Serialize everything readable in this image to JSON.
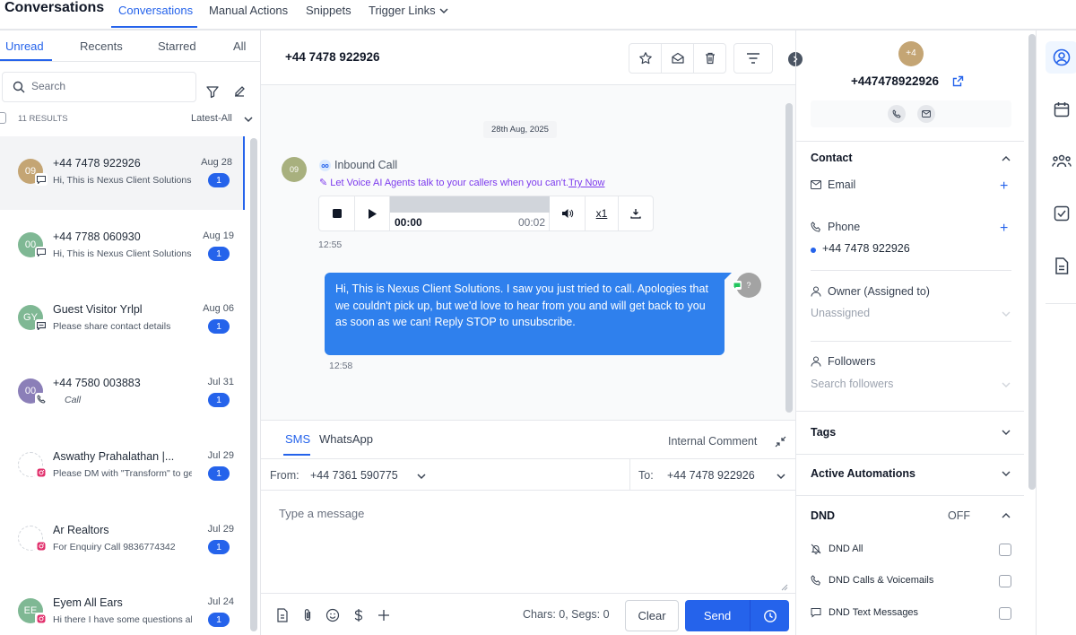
{
  "topnav": {
    "title": "Conversations",
    "tabs": [
      "Conversations",
      "Manual Actions",
      "Snippets",
      "Trigger Links"
    ]
  },
  "left": {
    "tabs": [
      "Unread",
      "Recents",
      "Starred",
      "All"
    ],
    "search_placeholder": "Search",
    "results": "11 RESULTS",
    "sort": "Latest-All",
    "conversations": [
      {
        "initials": "09",
        "name": "+44 7478 922926",
        "preview": "Hi, This is Nexus Client Solutions",
        "date": "Aug 28",
        "count": "1",
        "color": "#c4a574",
        "channel": "sms",
        "selected": true
      },
      {
        "initials": "00",
        "name": "+44 7788 060930",
        "preview": "Hi, This is Nexus Client Solutions.",
        "date": "Aug 19",
        "count": "1",
        "color": "#7fb894",
        "channel": "sms"
      },
      {
        "initials": "GY",
        "name": "Guest Visitor Yrlpl",
        "preview": "Please share contact details",
        "date": "Aug 06",
        "count": "1",
        "color": "#7fb894",
        "channel": "chat"
      },
      {
        "initials": "00",
        "name": "+44 7580 003883",
        "preview": "Call",
        "date": "Jul 31",
        "count": "1",
        "color": "#8b7fb8",
        "channel": "call"
      },
      {
        "initials": "",
        "name": "Aswathy Prahalathan |...",
        "preview": "Please DM with \"Transform\" to ge",
        "date": "Jul 29",
        "count": "1",
        "color": "",
        "channel": "instagram"
      },
      {
        "initials": "",
        "name": "Ar Realtors",
        "preview": "For Enquiry Call 9836774342",
        "date": "Jul 29",
        "count": "1",
        "color": "",
        "channel": "instagram"
      },
      {
        "initials": "EE",
        "name": "Eyem All Ears",
        "preview": "Hi there I have some questions ab",
        "date": "Jul 24",
        "count": "1",
        "color": "#7fb894",
        "channel": "instagram"
      }
    ]
  },
  "chat": {
    "header_name": "+44 7478 922926",
    "date_pill": "28th Aug, 2025",
    "inbound": {
      "avatar": "09",
      "title": "Inbound Call",
      "promo": "Let Voice AI Agents talk to your callers when you can't.",
      "promo_link": "Try Now",
      "audio_current": "00:00",
      "audio_total": "00:02",
      "speed": "x1",
      "progress": 0,
      "time": "12:55"
    },
    "outbound": {
      "text": "Hi, This is Nexus Client Solutions. I saw you just tried to call. Apologies that we couldn't pick up, but we'd love to hear from you and will get back to you as soon as we can! Reply STOP to unsubscribe.",
      "avatar": "?",
      "time": "12:58"
    }
  },
  "composer": {
    "tabs": [
      "SMS",
      "WhatsApp"
    ],
    "internal_comment": "Internal Comment",
    "from_label": "From:",
    "from_value": "+44 7361 590775",
    "to_label": "To:",
    "to_value": "+44 7478 922926",
    "placeholder": "Type a message",
    "char_count": "Chars: 0, Segs: 0",
    "clear": "Clear",
    "send": "Send"
  },
  "contact": {
    "avatar": "+4",
    "phone": "+447478922926",
    "section_contact": "Contact",
    "email_label": "Email",
    "phone_label": "Phone",
    "phone_value": "+44 7478 922926",
    "owner_label": "Owner (Assigned to)",
    "owner_value": "Unassigned",
    "followers_label": "Followers",
    "followers_placeholder": "Search followers",
    "tags": "Tags",
    "automations": "Active Automations",
    "dnd": "DND",
    "dnd_state": "OFF",
    "dnd_items": [
      "DND All",
      "DND Calls & Voicemails",
      "DND Text Messages"
    ]
  },
  "colors": {
    "accent": "#2563eb",
    "bubble": "#2f80ed",
    "promo": "#7c3aed"
  },
  "icons": {
    "rail": [
      "user-circle-icon",
      "calendar-icon",
      "users-group-icon",
      "checkbox-icon",
      "document-icon"
    ]
  }
}
